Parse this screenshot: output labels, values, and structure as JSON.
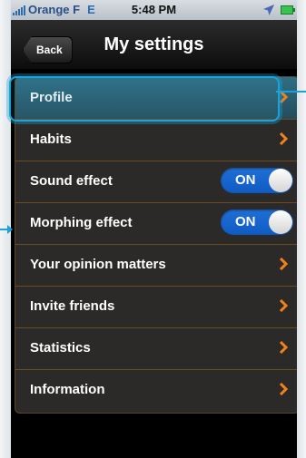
{
  "status_bar": {
    "carrier": "Orange F",
    "network": "E",
    "time": "5:48 PM"
  },
  "nav": {
    "back_label": "Back",
    "title": "My settings"
  },
  "settings": {
    "items": [
      {
        "label": "Profile",
        "type": "link"
      },
      {
        "label": "Habits",
        "type": "link"
      },
      {
        "label": "Sound effect",
        "type": "toggle",
        "toggle_label": "ON"
      },
      {
        "label": "Morphing effect",
        "type": "toggle",
        "toggle_label": "ON"
      },
      {
        "label": "Your opinion matters",
        "type": "link"
      },
      {
        "label": "Invite friends",
        "type": "link"
      },
      {
        "label": "Statistics",
        "type": "link"
      },
      {
        "label": "Information",
        "type": "link"
      }
    ]
  },
  "colors": {
    "accent": "#f0821e",
    "toggle_on": "#1f6fd6",
    "highlight": "#1aa3d8"
  }
}
